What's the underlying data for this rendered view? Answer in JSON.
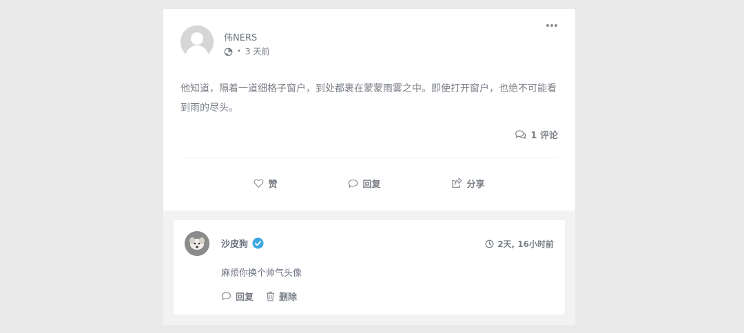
{
  "post": {
    "author": "伟NERS",
    "visibility_icon": "globe-icon",
    "separator": "•",
    "time": "3 天前",
    "content": "他知道，隔着一道细格子窗户，到处都裹在蒙蒙雨雾之中。即使打开窗户，也绝不可能看到雨的尽头。",
    "comment_count_label": "1 评论"
  },
  "actions": {
    "like_label": "赞",
    "reply_label": "回复",
    "share_label": "分享"
  },
  "comment": {
    "author": "沙皮狗",
    "verified_icon": "verified-check-icon",
    "time": "2天, 16小时前",
    "content": "麻烦你换个帅气头像",
    "reply_label": "回复",
    "delete_label": "删除"
  },
  "colors": {
    "page_bg": "#e9e9e9",
    "card_bg": "#ffffff",
    "comments_bg": "#f2f2f2",
    "verified": "#3ba8e0",
    "text": "#6b7280"
  }
}
